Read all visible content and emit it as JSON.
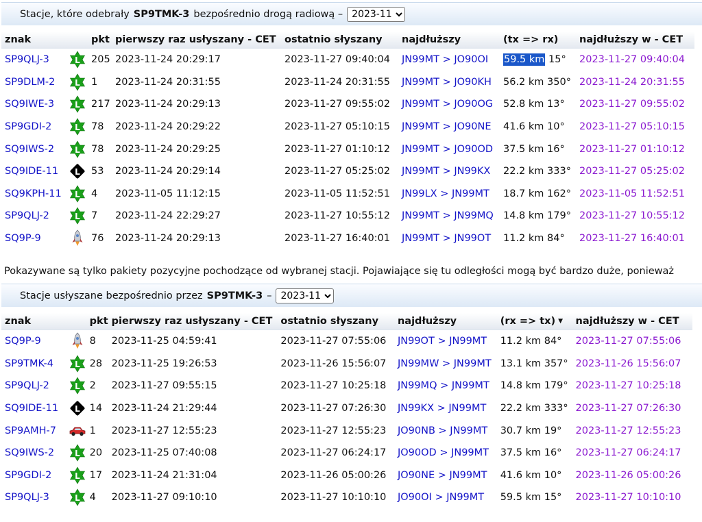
{
  "section1": {
    "prefix": "Stacje, które odebrały",
    "callsign": "SP9TMK-3",
    "suffix": "bezpośrednio drogą radiową –",
    "period": "2023-11",
    "columns": {
      "znak": "znak",
      "pkt": "pkt",
      "first": "pierwszy raz usłyszany - CET",
      "last": "ostatnio słyszany",
      "longest": "najdłuższy",
      "dir": "(tx => rx)",
      "longest_at": "najdłuższy w - CET"
    },
    "rows": [
      {
        "call": "SP9QLJ-3",
        "icon": "green-star-L-icon",
        "pkt": "205",
        "first": "2023-11-24 20:29:17",
        "last": "2023-11-27 09:40:04",
        "from": "JN99MT",
        "sep": ">",
        "to": "JO90OI",
        "dist": "59.5 km",
        "bearing": "15°",
        "when": "2023-11-27 09:40:04"
      },
      {
        "call": "SP9DLM-2",
        "icon": "green-star-L-icon",
        "pkt": "1",
        "first": "2023-11-24 20:31:55",
        "last": "2023-11-24 20:31:55",
        "from": "JN99MT",
        "sep": ">",
        "to": "JO90KH",
        "dist": "56.2 km",
        "bearing": "350°",
        "when": "2023-11-24 20:31:55"
      },
      {
        "call": "SQ9IWE-3",
        "icon": "green-star-L-icon",
        "pkt": "217",
        "first": "2023-11-24 20:29:13",
        "last": "2023-11-27 09:55:02",
        "from": "JN99MT",
        "sep": ">",
        "to": "JO90OG",
        "dist": "52.8 km",
        "bearing": "13°",
        "when": "2023-11-27 09:55:02"
      },
      {
        "call": "SP9GDI-2",
        "icon": "green-star-L-icon",
        "pkt": "78",
        "first": "2023-11-24 20:29:22",
        "last": "2023-11-27 05:10:15",
        "from": "JN99MT",
        "sep": ">",
        "to": "JO90NE",
        "dist": "41.6 km",
        "bearing": "10°",
        "when": "2023-11-27 05:10:15"
      },
      {
        "call": "SQ9IWS-2",
        "icon": "green-star-L-icon",
        "pkt": "78",
        "first": "2023-11-24 20:29:25",
        "last": "2023-11-27 01:10:12",
        "from": "JN99MT",
        "sep": ">",
        "to": "JO90OD",
        "dist": "37.5 km",
        "bearing": "16°",
        "when": "2023-11-27 01:10:12"
      },
      {
        "call": "SQ9IDE-11",
        "icon": "black-diamond-L-icon",
        "pkt": "53",
        "first": "2023-11-24 20:29:14",
        "last": "2023-11-27 05:25:02",
        "from": "JN99MT",
        "sep": ">",
        "to": "JN99KX",
        "dist": "22.2 km",
        "bearing": "333°",
        "when": "2023-11-27 05:25:02"
      },
      {
        "call": "SQ9KPH-11",
        "icon": "green-star-L-icon",
        "pkt": "4",
        "first": "2023-11-05 11:12:15",
        "last": "2023-11-05 11:52:51",
        "from": "JN99LX",
        "sep": ">",
        "to": "JN99MT",
        "dist": "18.7 km",
        "bearing": "162°",
        "when": "2023-11-05 11:52:51"
      },
      {
        "call": "SP9QLJ-2",
        "icon": "green-star-L-icon",
        "pkt": "7",
        "first": "2023-11-24 22:29:27",
        "last": "2023-11-27 10:55:12",
        "from": "JN99MT",
        "sep": ">",
        "to": "JN99MQ",
        "dist": "14.8 km",
        "bearing": "179°",
        "when": "2023-11-27 10:55:12"
      },
      {
        "call": "SQ9P-9",
        "icon": "rocket-icon",
        "pkt": "76",
        "first": "2023-11-24 20:29:13",
        "last": "2023-11-27 16:40:01",
        "from": "JN99MT",
        "sep": ">",
        "to": "JN99OT",
        "dist": "11.2 km",
        "bearing": "84°",
        "when": "2023-11-27 16:40:01"
      }
    ]
  },
  "notice": "Pokazywane są tylko pakiety pozycyjne pochodzące od wybranej stacji. Pojawiające się tu odległości mogą być bardzo duże, ponieważ",
  "section2": {
    "prefix": "Stacje usłyszane bezpośrednio przez",
    "callsign": "SP9TMK-3",
    "suffix": "–",
    "period": "2023-11",
    "columns": {
      "znak": "znak",
      "pkt": "pkt",
      "first": "pierwszy raz usłyszany - CET",
      "last": "ostatnio słyszany",
      "longest": "najdłuższy",
      "dir": "(rx => tx)",
      "sort_arrow": "▼",
      "longest_at": "najdłuższy w - CET"
    },
    "rows": [
      {
        "call": "SQ9P-9",
        "icon": "rocket-icon",
        "pkt": "8",
        "first": "2023-11-25 04:59:41",
        "last": "2023-11-27 07:55:06",
        "from": "JN99OT",
        "sep": ">",
        "to": "JN99MT",
        "dist": "11.2 km",
        "bearing": "84°",
        "when": "2023-11-27 07:55:06"
      },
      {
        "call": "SP9TMK-4",
        "icon": "green-star-L-icon",
        "pkt": "28",
        "first": "2023-11-25 19:26:53",
        "last": "2023-11-26 15:56:07",
        "from": "JN99MW",
        "sep": ">",
        "to": "JN99MT",
        "dist": "13.1 km",
        "bearing": "357°",
        "when": "2023-11-26 15:56:07"
      },
      {
        "call": "SP9QLJ-2",
        "icon": "green-star-L-icon",
        "pkt": "2",
        "first": "2023-11-27 09:55:15",
        "last": "2023-11-27 10:25:18",
        "from": "JN99MQ",
        "sep": ">",
        "to": "JN99MT",
        "dist": "14.8 km",
        "bearing": "179°",
        "when": "2023-11-27 10:25:18"
      },
      {
        "call": "SQ9IDE-11",
        "icon": "black-diamond-L-icon",
        "pkt": "14",
        "first": "2023-11-24 21:29:44",
        "last": "2023-11-27 07:26:30",
        "from": "JN99KX",
        "sep": ">",
        "to": "JN99MT",
        "dist": "22.2 km",
        "bearing": "333°",
        "when": "2023-11-27 07:26:30"
      },
      {
        "call": "SP9AMH-7",
        "icon": "red-car-icon",
        "pkt": "1",
        "first": "2023-11-27 12:55:23",
        "last": "2023-11-27 12:55:23",
        "from": "JO90NB",
        "sep": ">",
        "to": "JN99MT",
        "dist": "30.7 km",
        "bearing": "19°",
        "when": "2023-11-27 12:55:23"
      },
      {
        "call": "SQ9IWS-2",
        "icon": "green-star-L-icon",
        "pkt": "20",
        "first": "2023-11-25 07:40:08",
        "last": "2023-11-27 06:24:17",
        "from": "JO90OD",
        "sep": ">",
        "to": "JN99MT",
        "dist": "37.5 km",
        "bearing": "16°",
        "when": "2023-11-27 06:24:17"
      },
      {
        "call": "SP9GDI-2",
        "icon": "green-star-L-icon",
        "pkt": "17",
        "first": "2023-11-24 21:31:04",
        "last": "2023-11-26 05:00:26",
        "from": "JO90NE",
        "sep": ">",
        "to": "JN99MT",
        "dist": "41.6 km",
        "bearing": "10°",
        "when": "2023-11-26 05:00:26"
      },
      {
        "call": "SP9QLJ-3",
        "icon": "green-star-L-icon",
        "pkt": "4",
        "first": "2023-11-27 09:10:10",
        "last": "2023-11-27 10:10:10",
        "from": "JO90OI",
        "sep": ">",
        "to": "JN99MT",
        "dist": "59.5 km",
        "bearing": "15°",
        "when": "2023-11-27 10:10:10"
      }
    ]
  },
  "colors": {
    "link": "#1414c8",
    "visited_link": "#8b1ad0",
    "selection": "#1a57c9",
    "header_band": "#dde9f6",
    "icon_green": "#1aa01a"
  }
}
